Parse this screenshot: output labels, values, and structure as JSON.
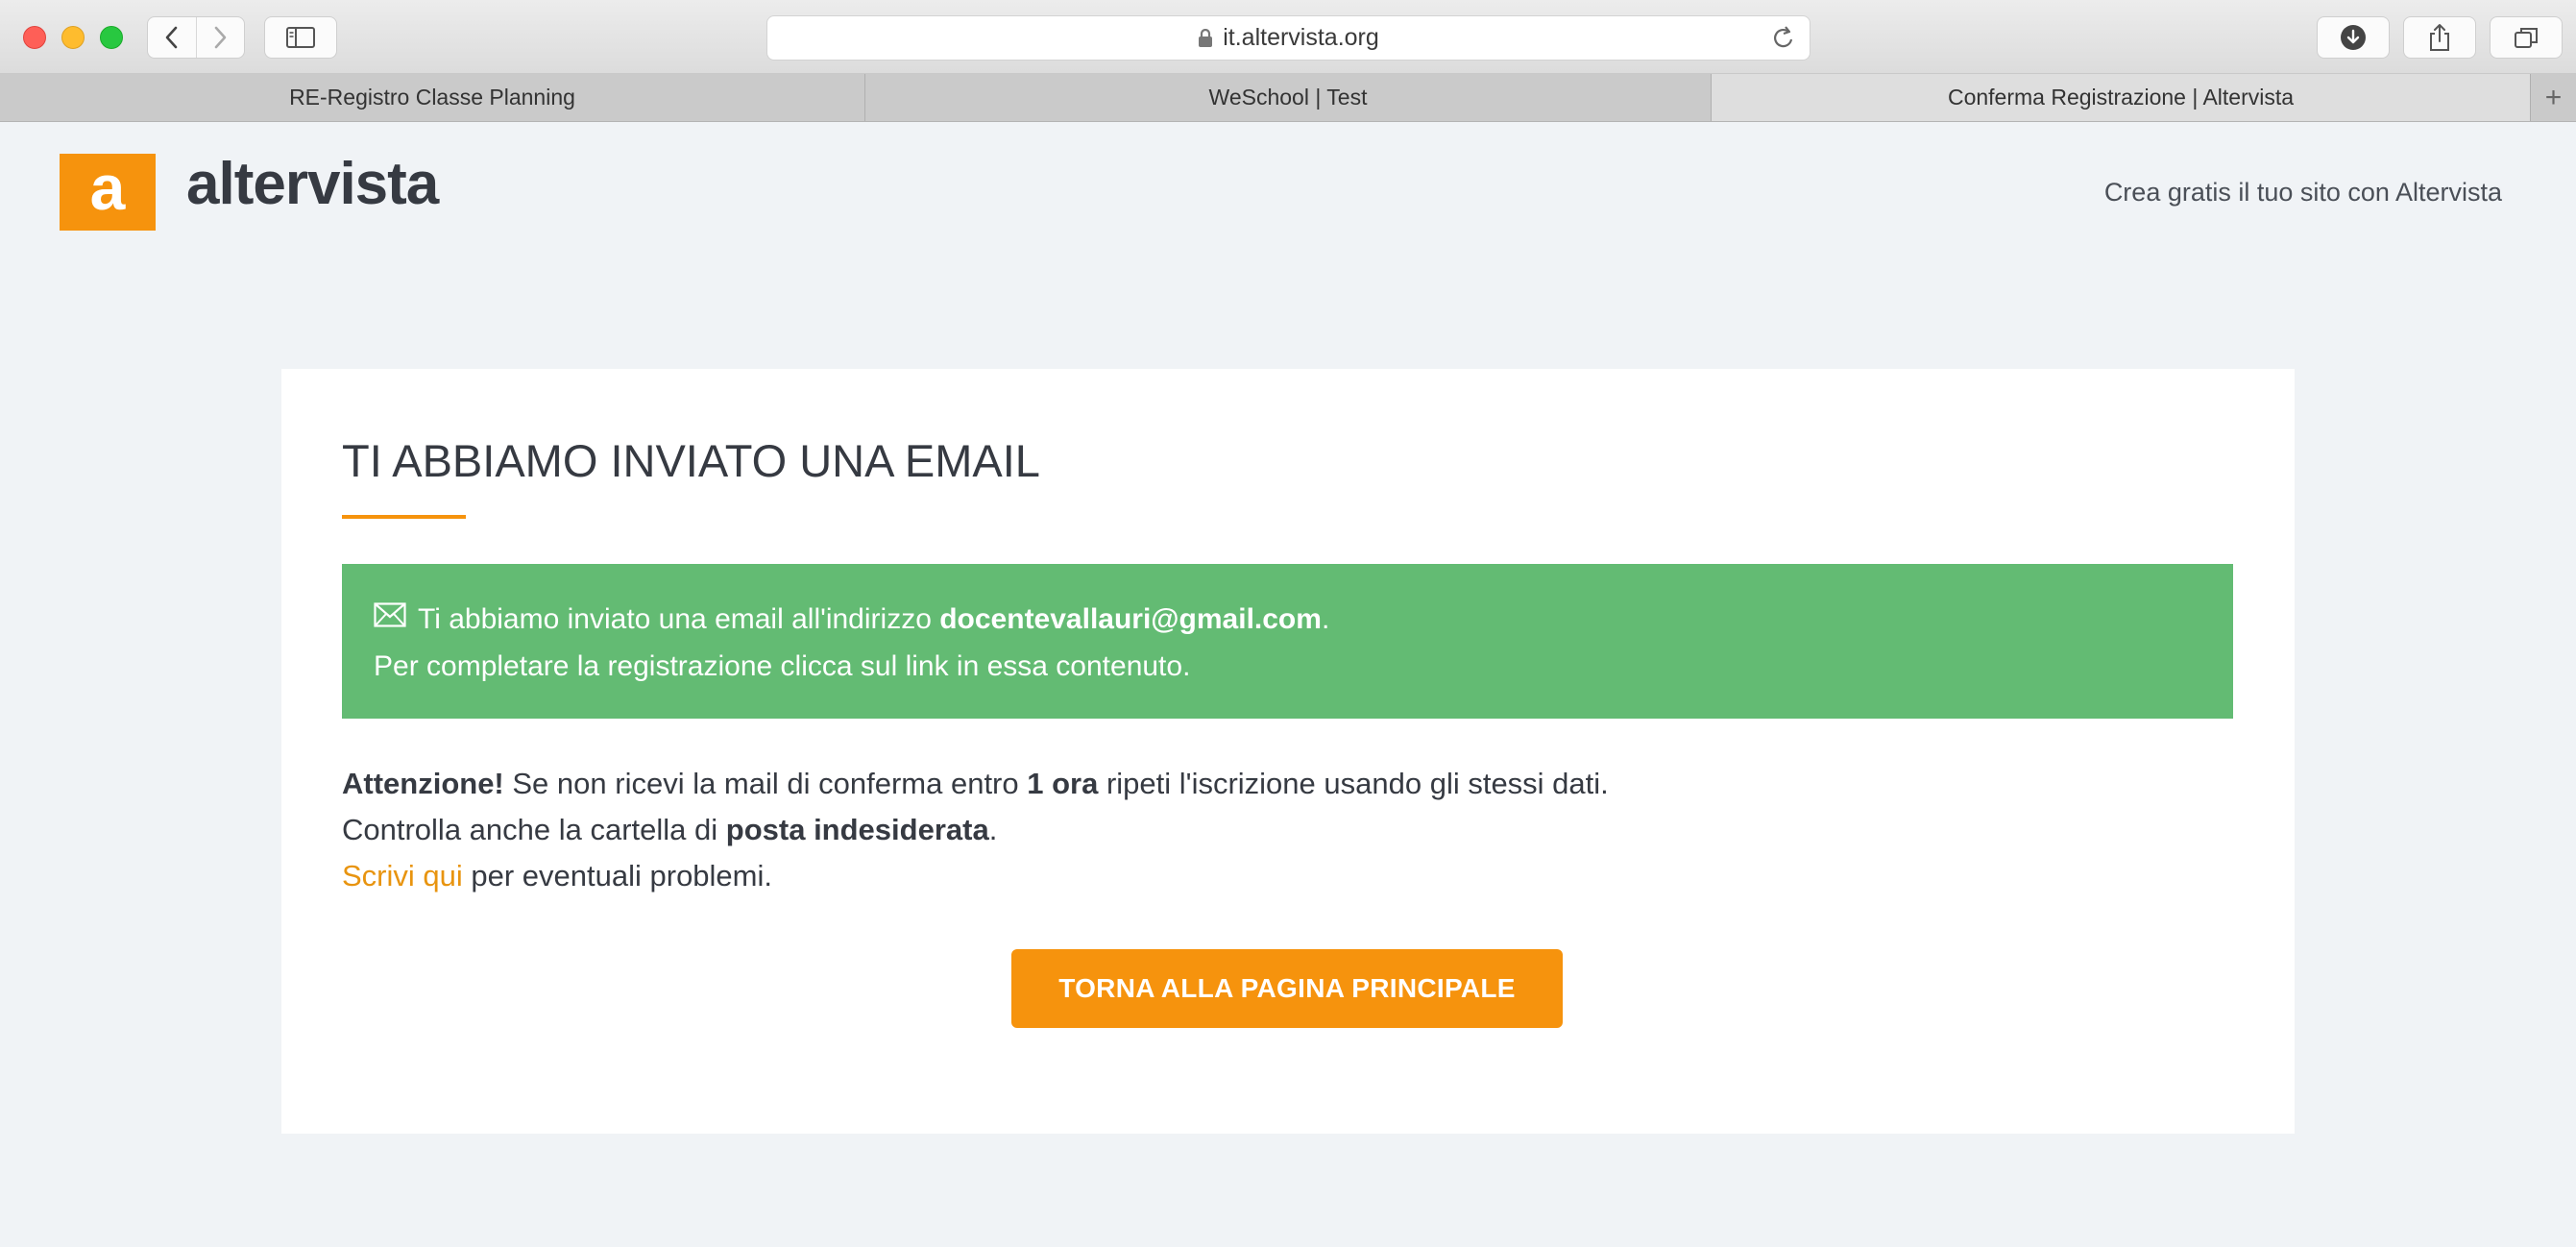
{
  "browser": {
    "url": "it.altervista.org",
    "tabs": [
      {
        "label": "RE-Registro Classe Planning"
      },
      {
        "label": "WeSchool | Test"
      },
      {
        "label": "Conferma Registrazione | Altervista"
      }
    ],
    "new_tab_label": "+"
  },
  "site": {
    "logo_letter": "a",
    "logo_text": "altervista",
    "header_link": "Crea gratis il tuo sito con Altervista",
    "brand_color": "#f6930d"
  },
  "card": {
    "title": "TI ABBIAMO INVIATO UNA EMAIL",
    "alert": {
      "line1_prefix": "Ti abbiamo inviato una email all'indirizzo ",
      "email": "docentevallauri@gmail.com",
      "line1_suffix": ".",
      "line2": "Per completare la registrazione clicca sul link in essa contenuto.",
      "color": "#63bb73"
    },
    "info": {
      "warning_label": "Attenzione!",
      "line1_a": " Se non ricevi la mail di conferma entro ",
      "line1_bold": "1 ora",
      "line1_b": " ripeti l'iscrizione usando gli stessi dati.",
      "line2_a": "Controlla anche la cartella di ",
      "line2_bold": "posta indesiderata",
      "line2_b": ".",
      "link_label": "Scrivi qui",
      "line3_rest": " per eventuali problemi."
    },
    "cta_label": "TORNA ALLA PAGINA PRINCIPALE"
  }
}
